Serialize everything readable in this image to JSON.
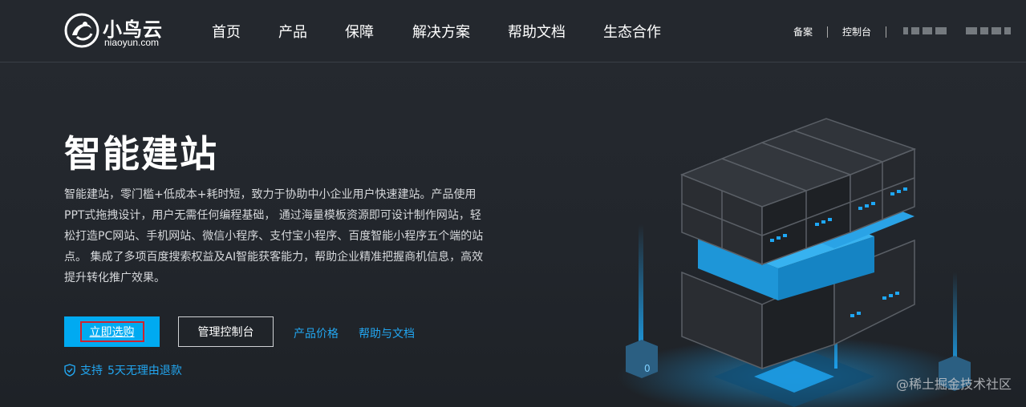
{
  "header": {
    "logo_text": "小鸟云",
    "logo_sub": "niaoyun.com",
    "nav": [
      "首页",
      "产品",
      "保障",
      "解决方案",
      "帮助文档",
      "生态合作"
    ],
    "right_links": [
      "备案",
      "控制台"
    ]
  },
  "hero": {
    "title": "智能建站",
    "description": "智能建站，零门槛+低成本+耗时短，致力于协助中小企业用户快速建站。产品使用PPT式拖拽设计，用户无需任何编程基础， 通过海量模板资源即可设计制作网站，轻松打造PC网站、手机网站、微信小程序、支付宝小程序、百度智能小程序五个端的站点。 集成了多项百度搜索权益及AI智能获客能力，帮助企业精准把握商机信息，高效提升转化推广效果。",
    "buy_label": "立即选购",
    "console_label": "管理控制台",
    "price_link": "产品价格",
    "docs_link": "帮助与文档",
    "support_prefix": "支持",
    "support_text": "5天无理由退款"
  },
  "watermark": "@稀土掘金技术社区",
  "colors": {
    "accent": "#00aaf1",
    "link": "#22a6f0",
    "background": "#23272d",
    "highlight_border": "#d0232e"
  },
  "icons": {
    "logo": "bird-swirl-logo",
    "support": "shield-check-icon",
    "illustration": "isometric-cube-3d"
  }
}
